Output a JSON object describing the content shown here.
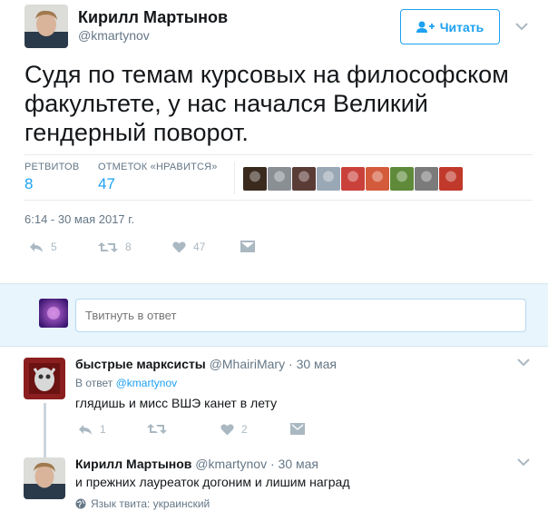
{
  "tweet": {
    "author_name": "Кирилл Мартынов",
    "author_handle": "@kmartynov",
    "follow_label": "Читать",
    "text": "Судя по темам курсовых на философском факультете, у нас начался Великий гендерный поворот.",
    "retweets_label": "РЕТВИТОВ",
    "retweets_count": "8",
    "likes_label": "ОТМЕТОК «НРАВИТСЯ»",
    "likes_count": "47",
    "timestamp": "6:14 - 30 мая 2017 г.",
    "actions": {
      "reply_count": "5",
      "retweet_count": "8",
      "like_count": "47"
    },
    "likers": [
      {
        "icon": "liker-avatar-1",
        "color": "#3a2a1e"
      },
      {
        "icon": "liker-avatar-2",
        "color": "#8a8f94"
      },
      {
        "icon": "liker-avatar-3",
        "color": "#5a3b35"
      },
      {
        "icon": "liker-avatar-4",
        "color": "#9aa8b6"
      },
      {
        "icon": "liker-avatar-5",
        "color": "#c9413a"
      },
      {
        "icon": "liker-avatar-6",
        "color": "#d35b3c"
      },
      {
        "icon": "liker-avatar-7",
        "color": "#5f8a3a"
      },
      {
        "icon": "liker-avatar-8",
        "color": "#7b7b7b"
      },
      {
        "icon": "liker-avatar-9",
        "color": "#c0392b"
      }
    ]
  },
  "reply_box": {
    "placeholder": "Твитнуть в ответ"
  },
  "replies": [
    {
      "name": "быстрые марксисты",
      "handle": "@MhairiMary",
      "date": "30 мая",
      "context_prefix": "В ответ",
      "context_mention": "@kmartynov",
      "text": "глядишь и мисс ВШЭ канет в лету",
      "actions": {
        "reply_count": "1",
        "retweet_count": "",
        "like_count": "2"
      }
    },
    {
      "name": "Кирилл Мартынов",
      "handle": "@kmartynov",
      "date": "30 мая",
      "text": "и прежних лауреаток догоним и лишим наград",
      "language_note": "Язык твита: украинский"
    }
  ],
  "colors": {
    "accent": "#1da1f2",
    "muted": "#657786",
    "icon_gray": "#aab8c2",
    "reply_bg": "#e8f5fd"
  }
}
